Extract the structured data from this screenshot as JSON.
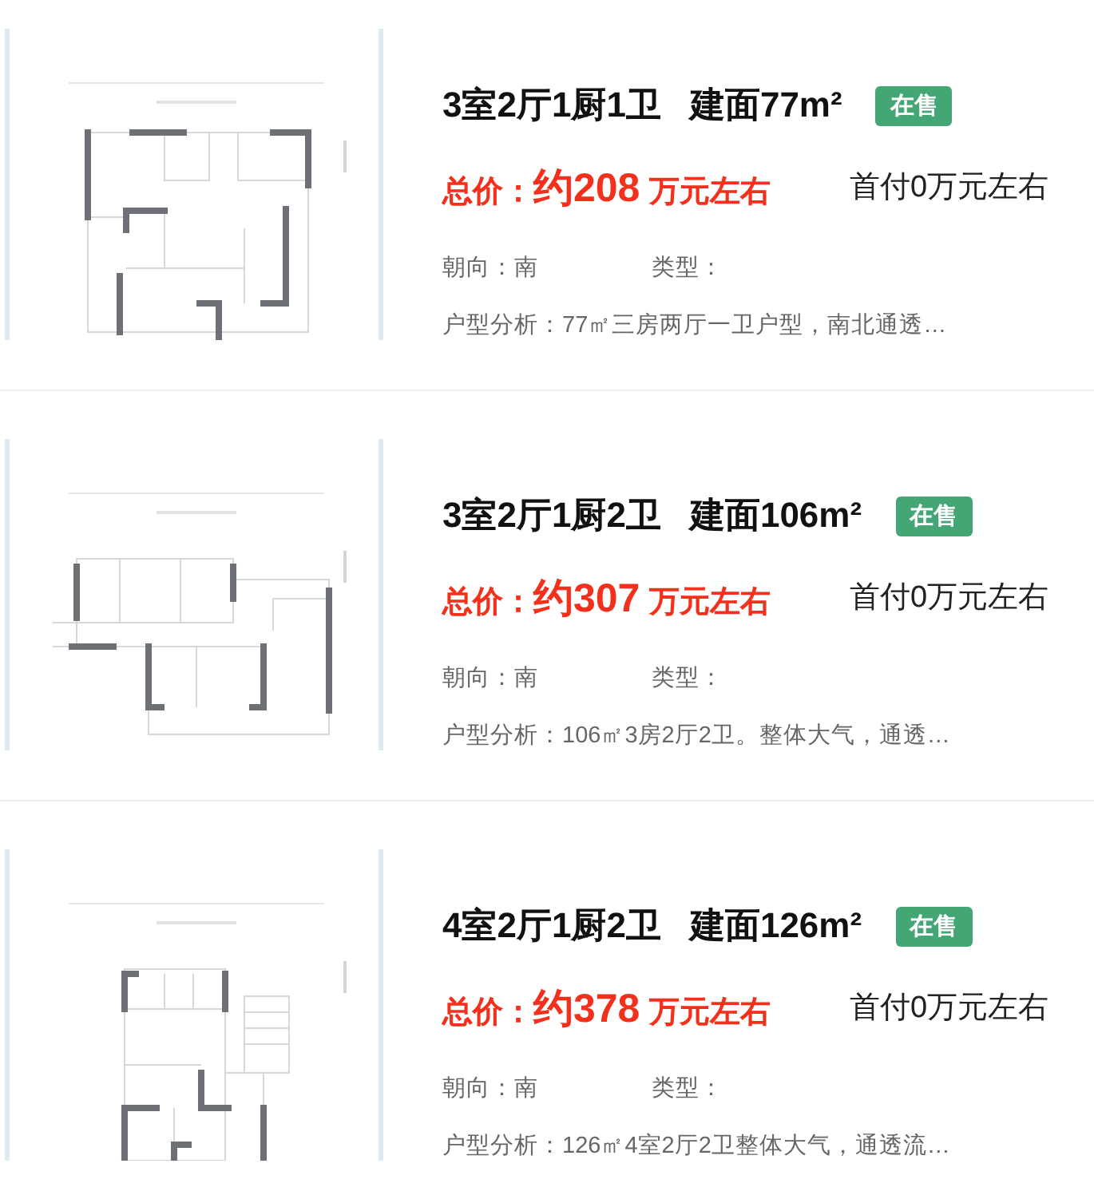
{
  "listings": [
    {
      "layout": "3室2厅1厨1卫",
      "area": "建面77m²",
      "status": "在售",
      "price_label": "总价：",
      "price": "约208",
      "price_unit": "万元左右",
      "down_payment": "首付0万元左右",
      "orientation": "朝向：南",
      "type": "类型：",
      "analysis": "户型分析：77㎡三房两厅一卫户型，南北通透…"
    },
    {
      "layout": "3室2厅1厨2卫",
      "area": "建面106m²",
      "status": "在售",
      "price_label": "总价：",
      "price": "约307",
      "price_unit": "万元左右",
      "down_payment": "首付0万元左右",
      "orientation": "朝向：南",
      "type": "类型：",
      "analysis": "户型分析：106㎡3房2厅2卫。整体大气，通透…"
    },
    {
      "layout": "4室2厅1厨2卫",
      "area": "建面126m²",
      "status": "在售",
      "price_label": "总价：",
      "price": "约378",
      "price_unit": "万元左右",
      "down_payment": "首付0万元左右",
      "orientation": "朝向：南",
      "type": "类型：",
      "analysis": "户型分析：126㎡4室2厅2卫整体大气，通透流…"
    }
  ]
}
